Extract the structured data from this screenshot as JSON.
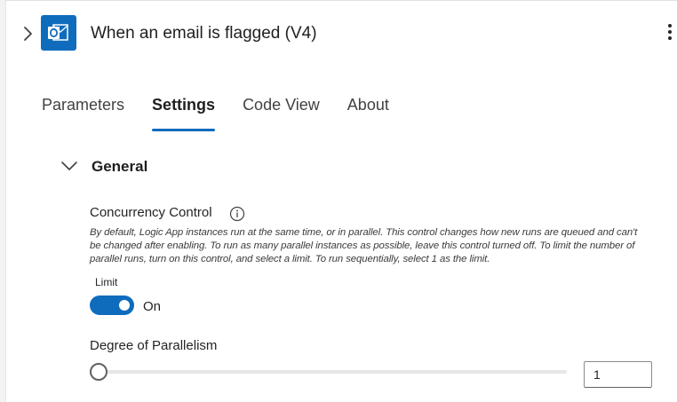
{
  "header": {
    "title": "When an email is flagged (V4)",
    "expand_icon": "chevron-right-icon",
    "app_icon": "outlook-icon",
    "app_color": "#0f6cbd",
    "more_icon": "more-vertical-icon"
  },
  "tabs": [
    {
      "label": "Parameters",
      "active": false
    },
    {
      "label": "Settings",
      "active": true
    },
    {
      "label": "Code View",
      "active": false
    },
    {
      "label": "About",
      "active": false
    }
  ],
  "section": {
    "title": "General",
    "expanded": true,
    "toggle_icon": "chevron-down-icon"
  },
  "concurrency": {
    "label": "Concurrency Control",
    "info_icon": "info-icon",
    "description": "By default, Logic App instances run at the same time, or in parallel. This control changes how new runs are queued and can't be changed after enabling. To run as many parallel instances as possible, leave this control turned off. To limit the number of parallel runs, turn on this control, and select a limit. To run sequentially, select 1 as the limit.",
    "limit_label": "Limit",
    "toggle_state": "On",
    "toggle_on": true,
    "toggle_color": "#0f6cbd"
  },
  "parallelism": {
    "label": "Degree of Parallelism",
    "value": "1",
    "slider_fraction": 0.0
  }
}
